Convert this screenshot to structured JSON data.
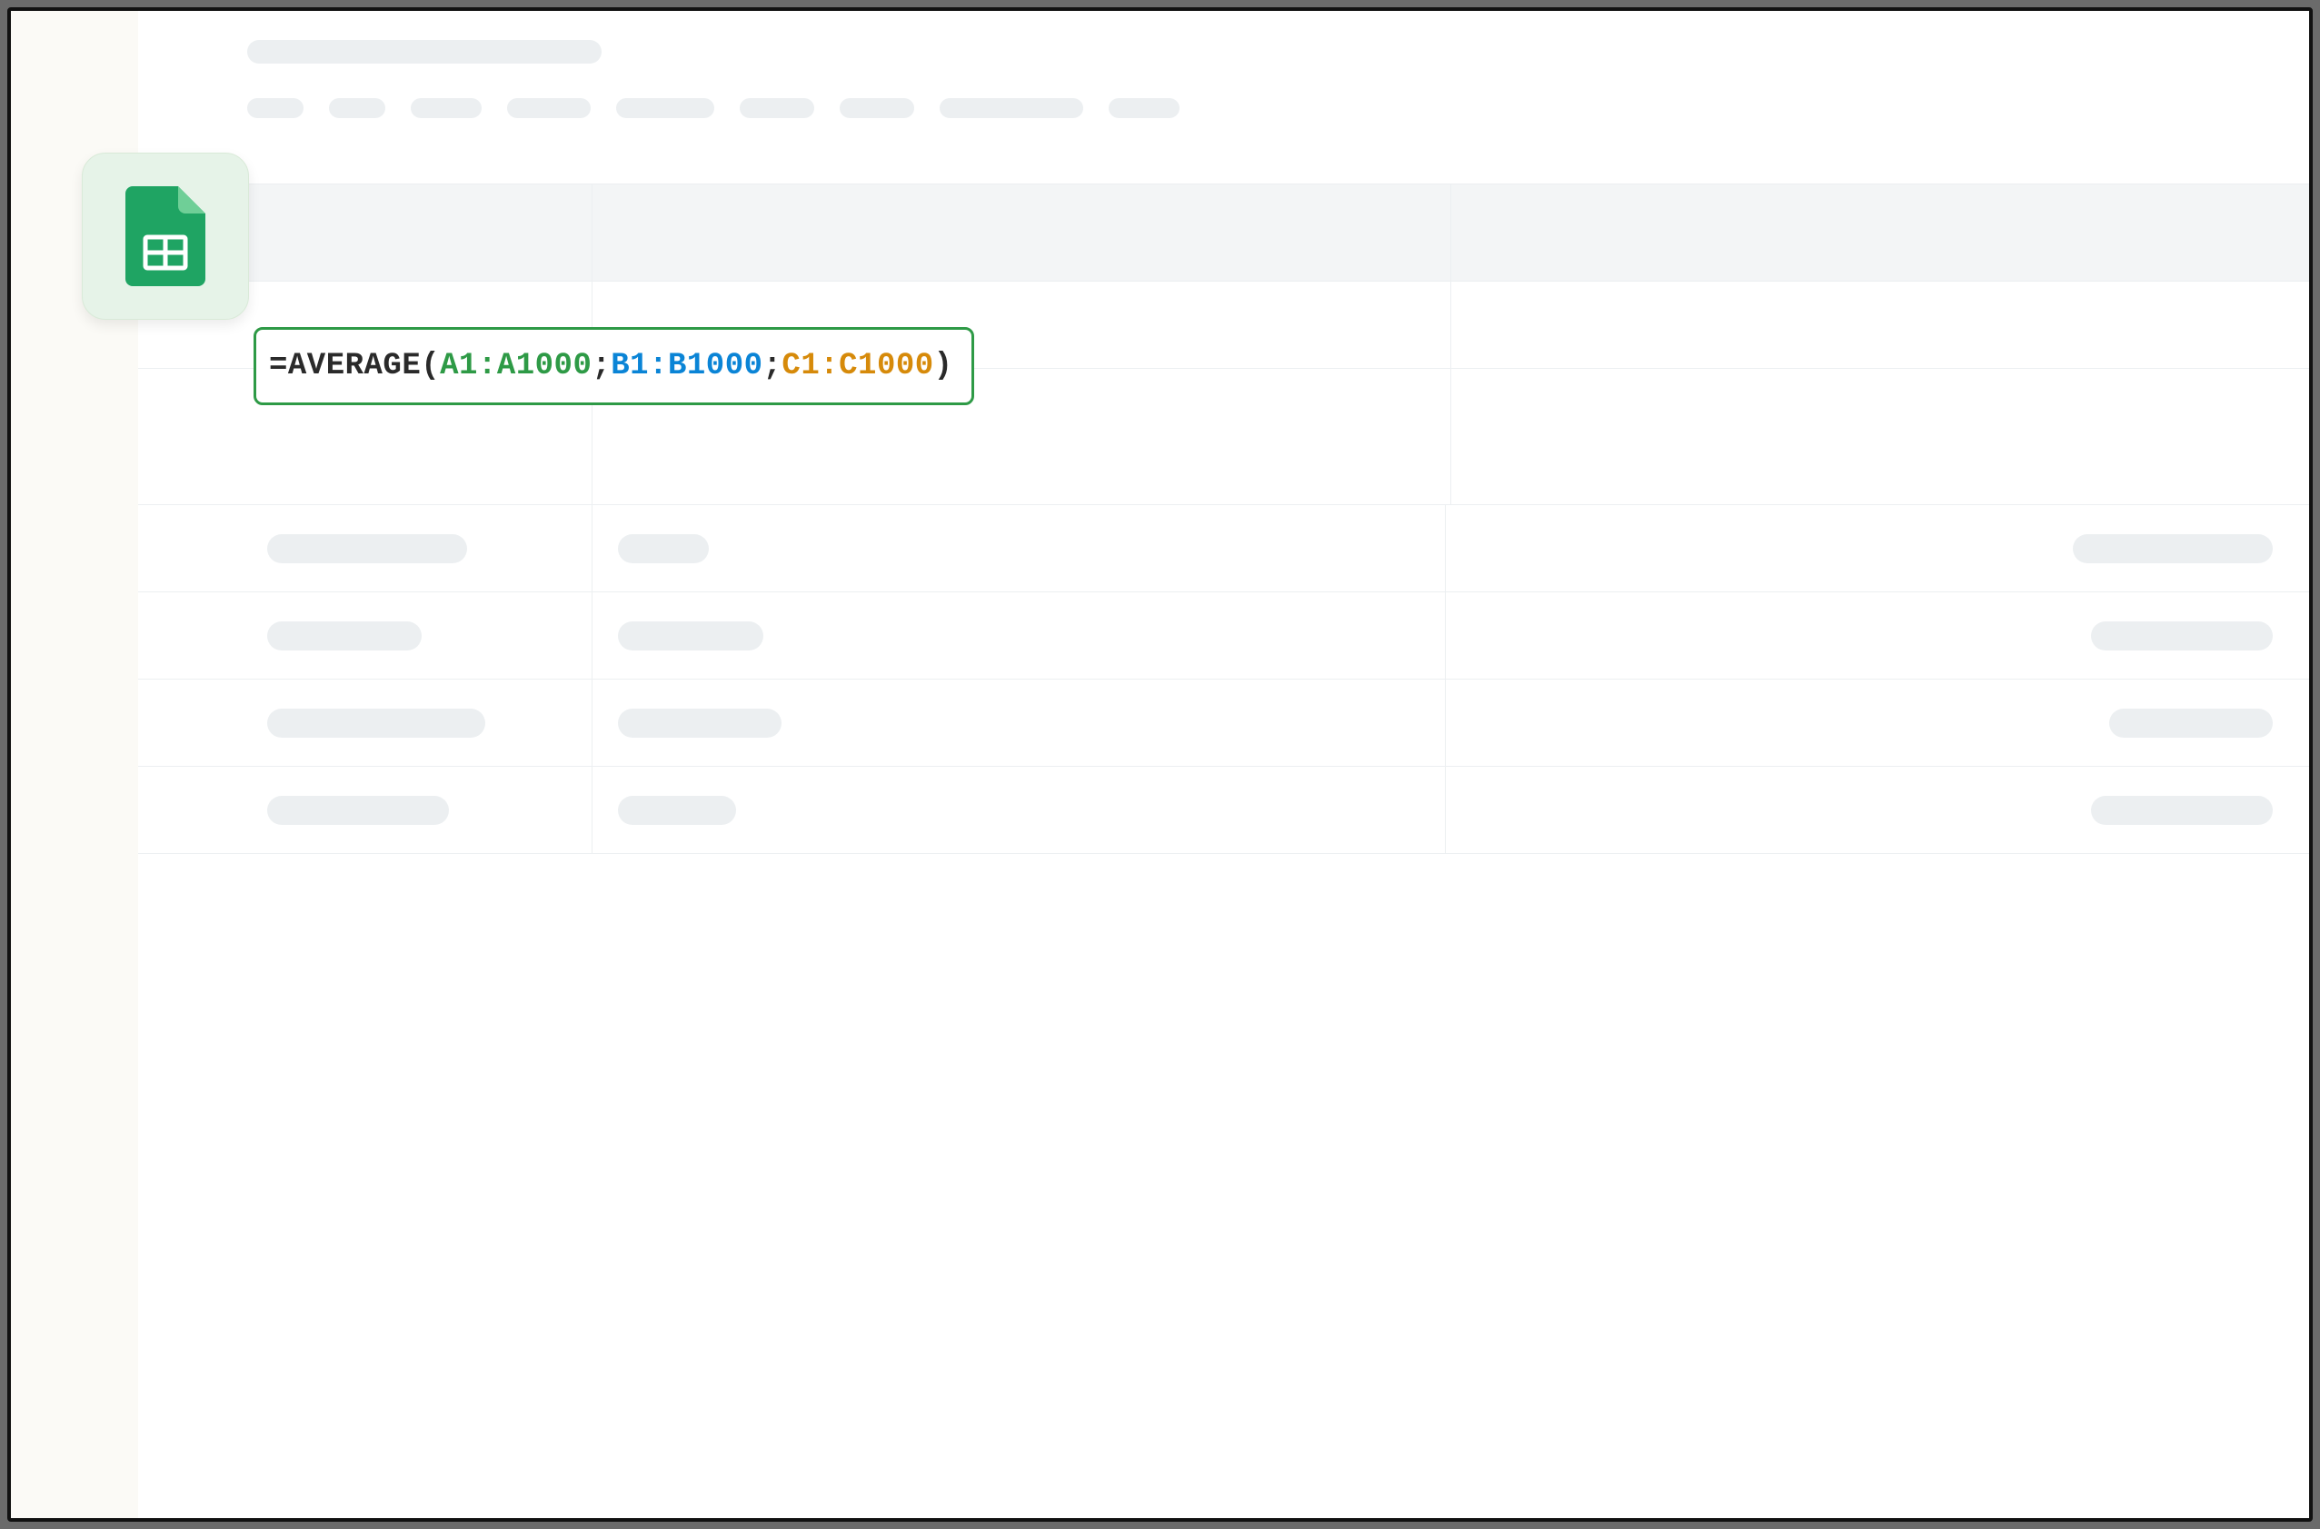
{
  "formula": {
    "prefix": "=AVERAGE(",
    "range1": "A1:A1000",
    "sep1": "; ",
    "range2": "B1:B1000",
    "sep2": "; ",
    "range3": "C1:C1000",
    "suffix": ")"
  },
  "icon": {
    "name": "google-sheets"
  },
  "colors": {
    "formula_border": "#2e9a46",
    "range_a": "#2e9a46",
    "range_b": "#0a84d6",
    "range_c": "#d68a0a"
  }
}
